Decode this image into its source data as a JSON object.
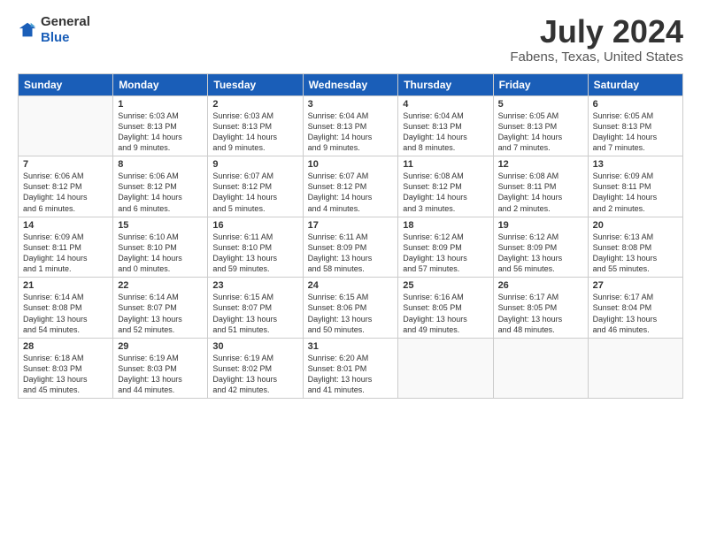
{
  "logo": {
    "general": "General",
    "blue": "Blue"
  },
  "header": {
    "title": "July 2024",
    "subtitle": "Fabens, Texas, United States"
  },
  "days_of_week": [
    "Sunday",
    "Monday",
    "Tuesday",
    "Wednesday",
    "Thursday",
    "Friday",
    "Saturday"
  ],
  "weeks": [
    [
      {
        "day": "",
        "info": ""
      },
      {
        "day": "1",
        "info": "Sunrise: 6:03 AM\nSunset: 8:13 PM\nDaylight: 14 hours\nand 9 minutes."
      },
      {
        "day": "2",
        "info": "Sunrise: 6:03 AM\nSunset: 8:13 PM\nDaylight: 14 hours\nand 9 minutes."
      },
      {
        "day": "3",
        "info": "Sunrise: 6:04 AM\nSunset: 8:13 PM\nDaylight: 14 hours\nand 9 minutes."
      },
      {
        "day": "4",
        "info": "Sunrise: 6:04 AM\nSunset: 8:13 PM\nDaylight: 14 hours\nand 8 minutes."
      },
      {
        "day": "5",
        "info": "Sunrise: 6:05 AM\nSunset: 8:13 PM\nDaylight: 14 hours\nand 7 minutes."
      },
      {
        "day": "6",
        "info": "Sunrise: 6:05 AM\nSunset: 8:13 PM\nDaylight: 14 hours\nand 7 minutes."
      }
    ],
    [
      {
        "day": "7",
        "info": "Sunrise: 6:06 AM\nSunset: 8:12 PM\nDaylight: 14 hours\nand 6 minutes."
      },
      {
        "day": "8",
        "info": "Sunrise: 6:06 AM\nSunset: 8:12 PM\nDaylight: 14 hours\nand 6 minutes."
      },
      {
        "day": "9",
        "info": "Sunrise: 6:07 AM\nSunset: 8:12 PM\nDaylight: 14 hours\nand 5 minutes."
      },
      {
        "day": "10",
        "info": "Sunrise: 6:07 AM\nSunset: 8:12 PM\nDaylight: 14 hours\nand 4 minutes."
      },
      {
        "day": "11",
        "info": "Sunrise: 6:08 AM\nSunset: 8:12 PM\nDaylight: 14 hours\nand 3 minutes."
      },
      {
        "day": "12",
        "info": "Sunrise: 6:08 AM\nSunset: 8:11 PM\nDaylight: 14 hours\nand 2 minutes."
      },
      {
        "day": "13",
        "info": "Sunrise: 6:09 AM\nSunset: 8:11 PM\nDaylight: 14 hours\nand 2 minutes."
      }
    ],
    [
      {
        "day": "14",
        "info": "Sunrise: 6:09 AM\nSunset: 8:11 PM\nDaylight: 14 hours\nand 1 minute."
      },
      {
        "day": "15",
        "info": "Sunrise: 6:10 AM\nSunset: 8:10 PM\nDaylight: 14 hours\nand 0 minutes."
      },
      {
        "day": "16",
        "info": "Sunrise: 6:11 AM\nSunset: 8:10 PM\nDaylight: 13 hours\nand 59 minutes."
      },
      {
        "day": "17",
        "info": "Sunrise: 6:11 AM\nSunset: 8:09 PM\nDaylight: 13 hours\nand 58 minutes."
      },
      {
        "day": "18",
        "info": "Sunrise: 6:12 AM\nSunset: 8:09 PM\nDaylight: 13 hours\nand 57 minutes."
      },
      {
        "day": "19",
        "info": "Sunrise: 6:12 AM\nSunset: 8:09 PM\nDaylight: 13 hours\nand 56 minutes."
      },
      {
        "day": "20",
        "info": "Sunrise: 6:13 AM\nSunset: 8:08 PM\nDaylight: 13 hours\nand 55 minutes."
      }
    ],
    [
      {
        "day": "21",
        "info": "Sunrise: 6:14 AM\nSunset: 8:08 PM\nDaylight: 13 hours\nand 54 minutes."
      },
      {
        "day": "22",
        "info": "Sunrise: 6:14 AM\nSunset: 8:07 PM\nDaylight: 13 hours\nand 52 minutes."
      },
      {
        "day": "23",
        "info": "Sunrise: 6:15 AM\nSunset: 8:07 PM\nDaylight: 13 hours\nand 51 minutes."
      },
      {
        "day": "24",
        "info": "Sunrise: 6:15 AM\nSunset: 8:06 PM\nDaylight: 13 hours\nand 50 minutes."
      },
      {
        "day": "25",
        "info": "Sunrise: 6:16 AM\nSunset: 8:05 PM\nDaylight: 13 hours\nand 49 minutes."
      },
      {
        "day": "26",
        "info": "Sunrise: 6:17 AM\nSunset: 8:05 PM\nDaylight: 13 hours\nand 48 minutes."
      },
      {
        "day": "27",
        "info": "Sunrise: 6:17 AM\nSunset: 8:04 PM\nDaylight: 13 hours\nand 46 minutes."
      }
    ],
    [
      {
        "day": "28",
        "info": "Sunrise: 6:18 AM\nSunset: 8:03 PM\nDaylight: 13 hours\nand 45 minutes."
      },
      {
        "day": "29",
        "info": "Sunrise: 6:19 AM\nSunset: 8:03 PM\nDaylight: 13 hours\nand 44 minutes."
      },
      {
        "day": "30",
        "info": "Sunrise: 6:19 AM\nSunset: 8:02 PM\nDaylight: 13 hours\nand 42 minutes."
      },
      {
        "day": "31",
        "info": "Sunrise: 6:20 AM\nSunset: 8:01 PM\nDaylight: 13 hours\nand 41 minutes."
      },
      {
        "day": "",
        "info": ""
      },
      {
        "day": "",
        "info": ""
      },
      {
        "day": "",
        "info": ""
      }
    ]
  ]
}
